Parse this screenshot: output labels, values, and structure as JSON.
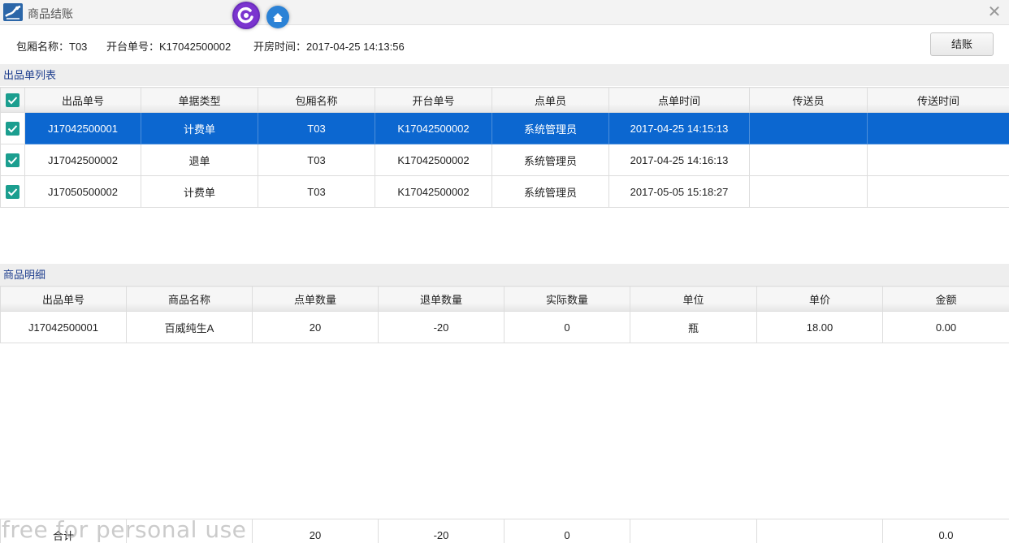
{
  "window": {
    "title": "商品结账",
    "close_label": "✕"
  },
  "info": {
    "room_name": "包厢名称：T03",
    "open_no": "开台单号：K17042500002",
    "open_time": "开房时间：2017-04-25 14:13:56",
    "checkout_label": "结账"
  },
  "order_section": {
    "title": "出品单列表",
    "columns": [
      "出品单号",
      "单据类型",
      "包厢名称",
      "开台单号",
      "点单员",
      "点单时间",
      "传送员",
      "传送时间"
    ],
    "rows": [
      {
        "checked": true,
        "selected": true,
        "cells": [
          "J17042500001",
          "计费单",
          "T03",
          "K17042500002",
          "系统管理员",
          "2017-04-25 14:15:13",
          "",
          ""
        ]
      },
      {
        "checked": true,
        "selected": false,
        "cells": [
          "J17042500002",
          "退单",
          "T03",
          "K17042500002",
          "系统管理员",
          "2017-04-25 14:16:13",
          "",
          ""
        ]
      },
      {
        "checked": true,
        "selected": false,
        "cells": [
          "J17050500002",
          "计费单",
          "T03",
          "K17042500002",
          "系统管理员",
          "2017-05-05 15:18:27",
          "",
          ""
        ]
      }
    ]
  },
  "detail_section": {
    "title": "商品明细",
    "columns": [
      "出品单号",
      "商品名称",
      "点单数量",
      "退单数量",
      "实际数量",
      "单位",
      "单价",
      "金额"
    ],
    "rows": [
      {
        "cells": [
          "J17042500001",
          "百威纯生A",
          "20",
          "-20",
          "0",
          "瓶",
          "18.00",
          "0.00"
        ]
      }
    ]
  },
  "totals": {
    "label": "合计",
    "order_qty": "20",
    "return_qty": "-20",
    "actual_qty": "0",
    "amount": "0.0"
  },
  "watermark": "free for personal use",
  "colors": {
    "selected_row": "#0c67d0",
    "checkbox": "#1b9e8f",
    "section_title": "#1f3f8f"
  }
}
